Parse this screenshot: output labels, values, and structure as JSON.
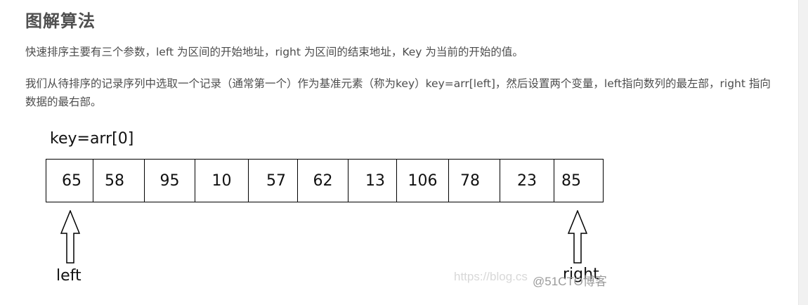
{
  "heading": "图解算法",
  "paragraph1": "快速排序主要有三个参数，left 为区间的开始地址，right 为区间的结束地址，Key 为当前的开始的值。",
  "paragraph2": "我们从待排序的记录序列中选取一个记录（通常第一个）作为基准元素（称为key）key=arr[left]，然后设置两个变量，left指向数列的最左部，right 指向数据的最右部。",
  "figure": {
    "key_label": "key=arr[0]",
    "array": [
      "65",
      "58",
      "95",
      "10",
      "57",
      "62",
      "13",
      "106",
      "78",
      "23",
      "85"
    ],
    "left_label": "left",
    "right_label": "right",
    "watermark_text": "https://blog.cs",
    "watermark_brand": "@51CTO博客"
  }
}
